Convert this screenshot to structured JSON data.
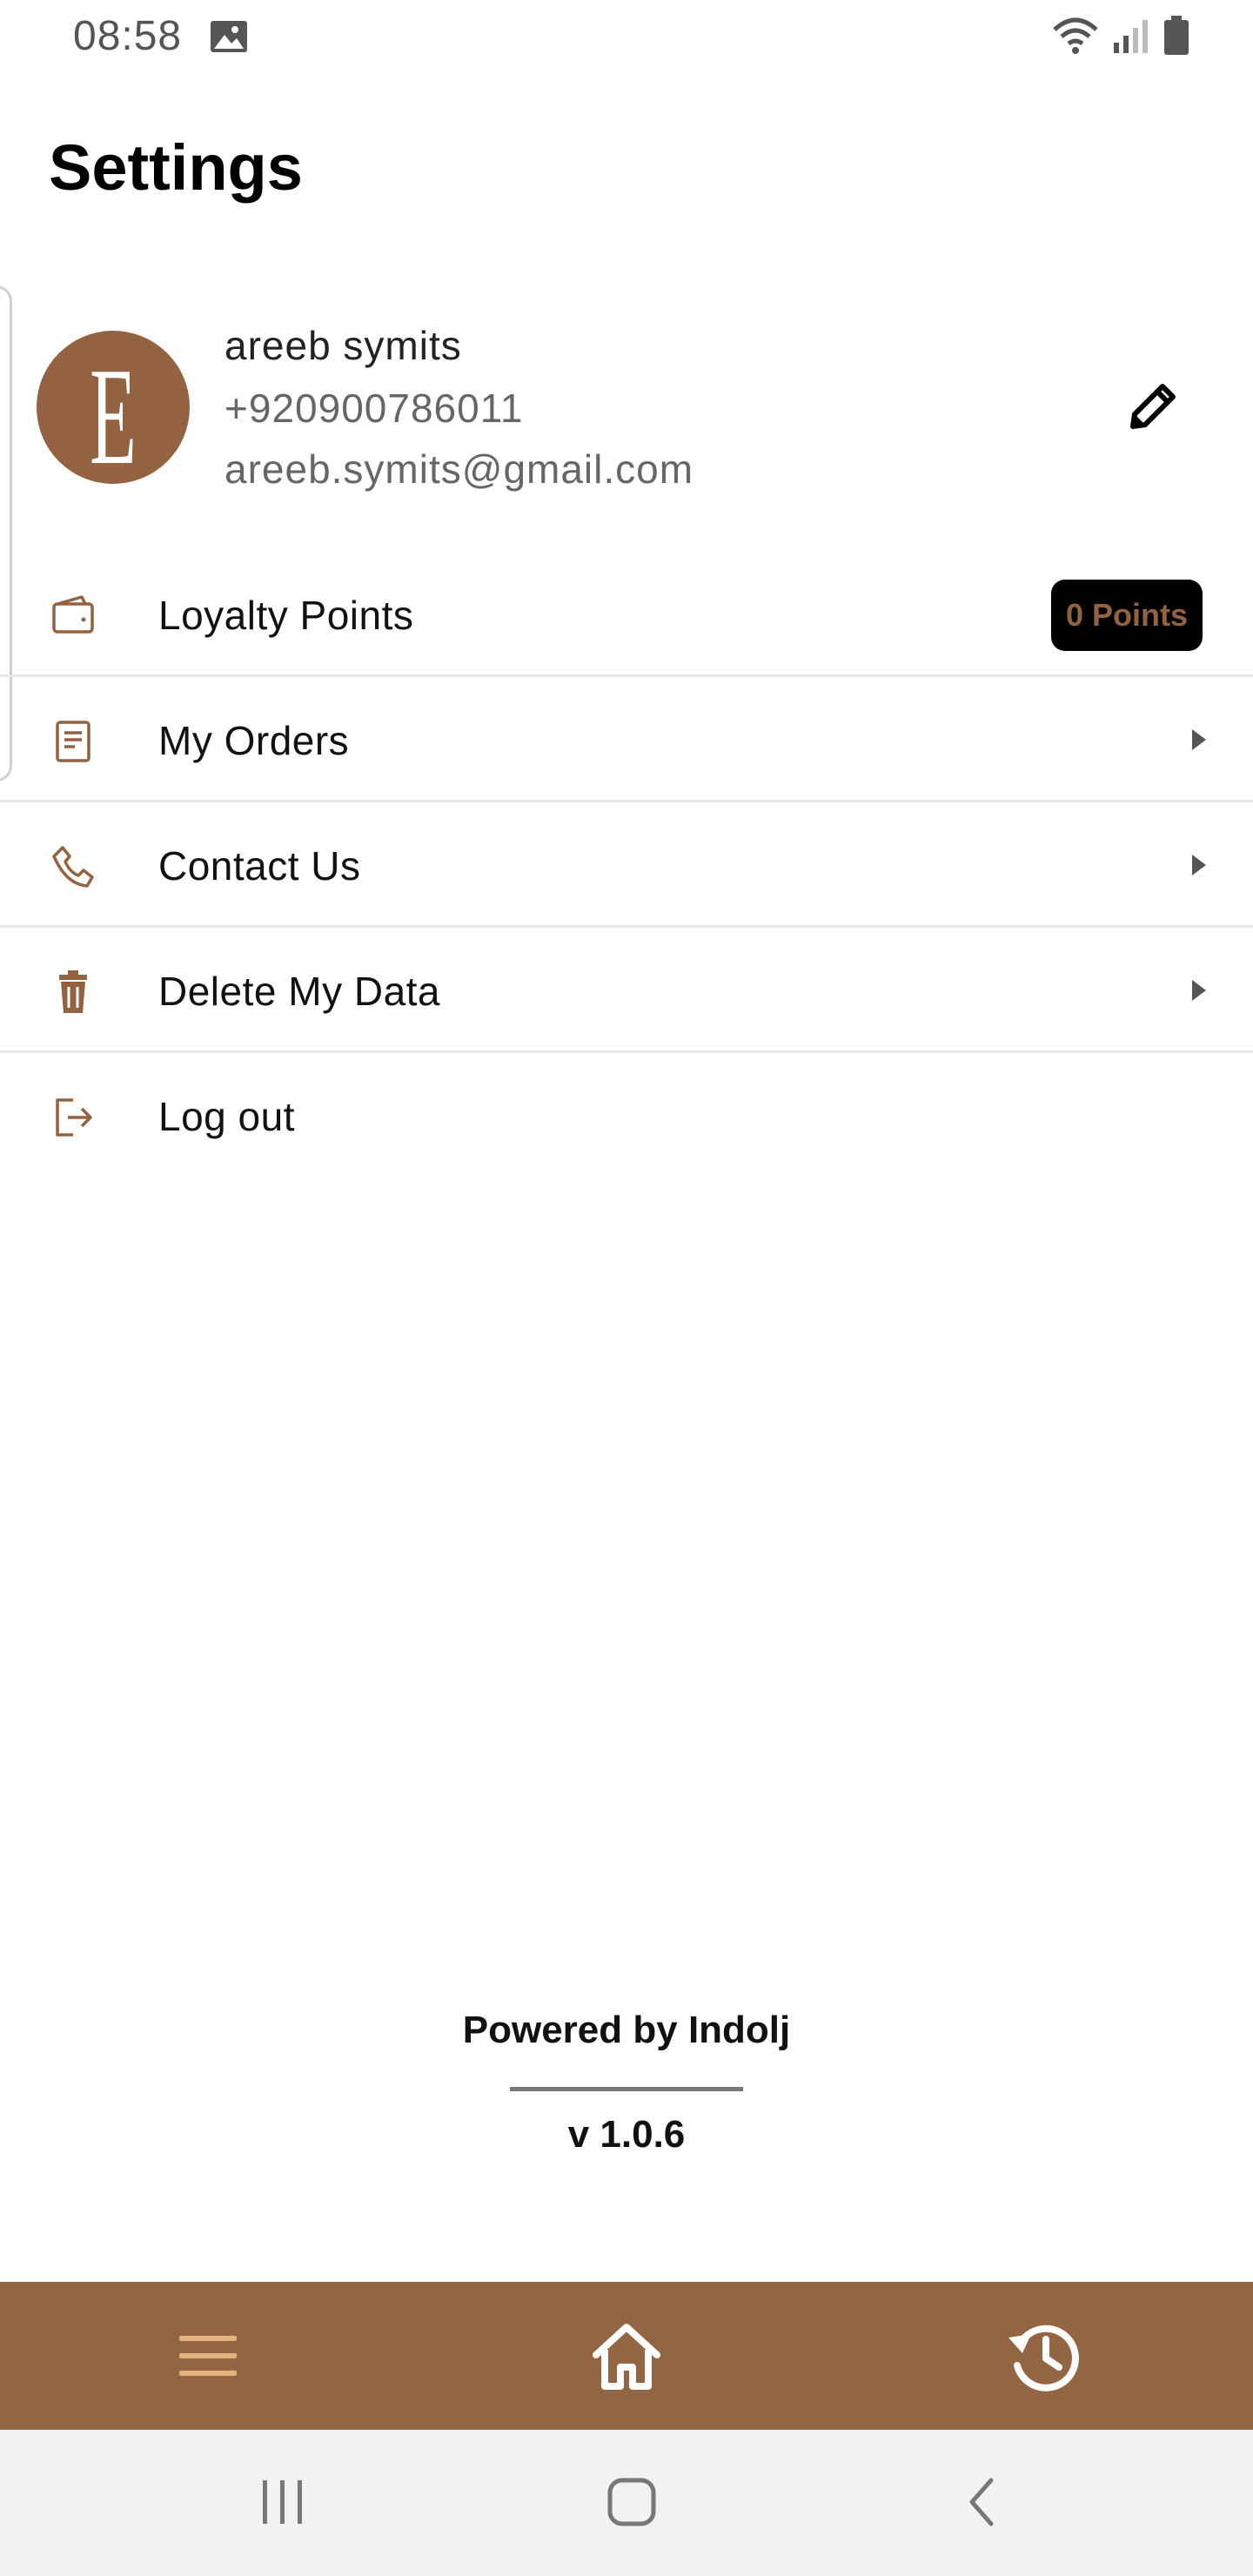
{
  "status_bar": {
    "time": "08:58",
    "icons": [
      "image-icon",
      "wifi-icon",
      "signal-icon",
      "battery-icon"
    ]
  },
  "page": {
    "title": "Settings"
  },
  "profile": {
    "avatar_letter": "E",
    "name": "areeb symits",
    "phone": "+920900786011",
    "email": "areeb.symits@gmail.com",
    "edit_icon": "pencil-icon"
  },
  "menu": {
    "items": [
      {
        "label": "Loyalty Points",
        "icon": "wallet-icon",
        "badge": "0 Points"
      },
      {
        "label": "My Orders",
        "icon": "receipt-icon"
      },
      {
        "label": "Contact Us",
        "icon": "phone-icon"
      },
      {
        "label": "Delete My Data",
        "icon": "trash-icon"
      },
      {
        "label": "Log out",
        "icon": "logout-icon"
      }
    ]
  },
  "footer": {
    "powered_by": "Powered by Indolj",
    "version": "v 1.0.6"
  },
  "bottom_bar": {
    "items": [
      "menu-icon",
      "home-icon",
      "history-icon"
    ]
  },
  "colors": {
    "accent": "#936240",
    "bottom_bar": "#936542",
    "badge_bg": "#000000"
  }
}
